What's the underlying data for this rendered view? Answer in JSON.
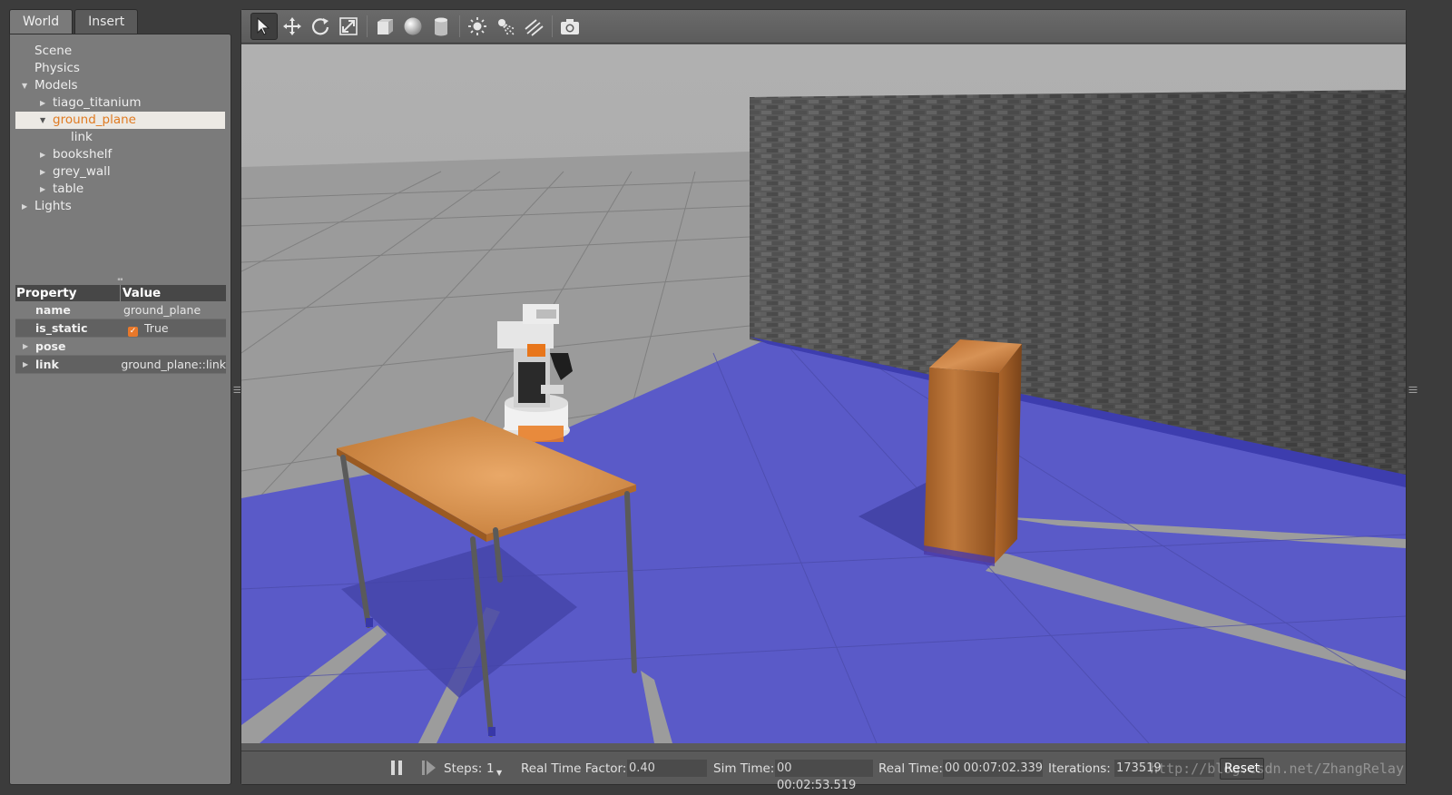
{
  "tabs": [
    {
      "label": "World",
      "active": true
    },
    {
      "label": "Insert",
      "active": false
    }
  ],
  "tree": {
    "scene": "Scene",
    "physics": "Physics",
    "models": "Models",
    "model_items": [
      "tiago_titanium",
      "ground_plane",
      "link",
      "bookshelf",
      "grey_wall",
      "table"
    ],
    "lights": "Lights",
    "selected": "ground_plane"
  },
  "properties": {
    "header_property": "Property",
    "header_value": "Value",
    "rows": [
      {
        "name": "name",
        "value": "ground_plane"
      },
      {
        "name": "is_static",
        "value": "True",
        "checked": true
      },
      {
        "name": "pose",
        "value": ""
      },
      {
        "name": "link",
        "value": "ground_plane::link"
      }
    ]
  },
  "toolbar": {
    "tools": [
      "select-icon",
      "translate-icon",
      "rotate-icon",
      "scale-icon",
      "box-icon",
      "sphere-icon",
      "cylinder-icon",
      "point-light-icon",
      "spot-light-icon",
      "directional-light-icon",
      "screenshot-icon"
    ],
    "active_tool": "select-icon"
  },
  "bottom_bar": {
    "steps_label": "Steps:",
    "steps_value": "1",
    "rtf_label": "Real Time Factor:",
    "rtf_value": "0.40",
    "sim_time_label": "Sim Time:",
    "sim_time_value": "00 00:02:53.519",
    "real_time_label": "Real Time:",
    "real_time_value": "00 00:07:02.339",
    "iterations_label": "Iterations:",
    "iterations_value": "173519",
    "reset_label": "Reset",
    "watermark": "http://blog.csdn.net/ZhangRelay"
  },
  "colors": {
    "floor_blue": "#5a5ac8",
    "ground_grey": "#9a9a9a",
    "selection_orange": "#e07b22"
  }
}
